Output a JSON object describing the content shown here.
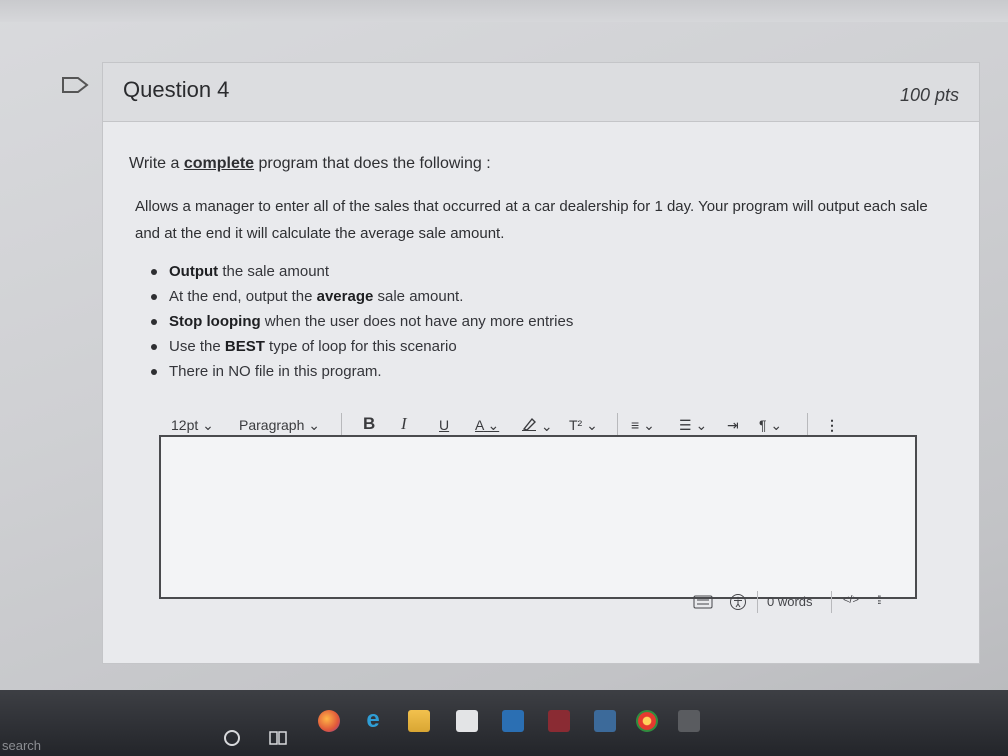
{
  "question": {
    "title": "Question 4",
    "points": "100 pts",
    "prompt_before": "Write a ",
    "prompt_emphasis": "complete",
    "prompt_after": " program that does the following :",
    "description": "Allows a manager to enter all of the sales that occurred at a car dealership for 1 day. Your program will output each sale and at the end it will calculate the average sale amount.",
    "bullets": [
      {
        "bold": "Output",
        "text": " the sale amount",
        "prefix": ""
      },
      {
        "prefix": "At the end, output the ",
        "bold": "average",
        "text": " sale amount."
      },
      {
        "bold": "Stop looping",
        "text": " when the user does not have any more entries",
        "prefix": ""
      },
      {
        "prefix": "Use the ",
        "bold": "BEST",
        "text": " type of loop for this scenario"
      },
      {
        "prefix": "There in NO file in this program.",
        "bold": "",
        "text": ""
      }
    ]
  },
  "toolbar": {
    "font_size": "12pt",
    "block_format": "Paragraph",
    "bold": "B",
    "italic": "I",
    "underline": "U",
    "text_color": "A",
    "superscript": "T²",
    "more": "⋮"
  },
  "editor": {
    "value": "",
    "word_count": "0 words",
    "html_toggle": "</>"
  },
  "taskbar": {
    "search_label": "search"
  },
  "colors": {
    "editor_border": "#4a4b4e",
    "card_bg": "#e9eaed"
  }
}
